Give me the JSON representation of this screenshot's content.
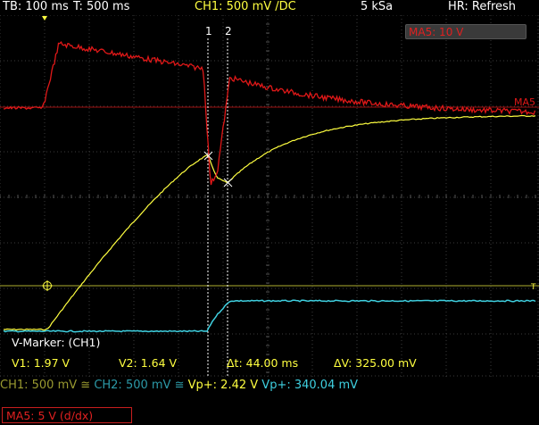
{
  "header": {
    "timebase": "TB: 100 ms",
    "trigger_time": "T: 500 ms",
    "channel1": "CH1: 500 mV /DC",
    "sample_rate": "5 kSa",
    "resolution_mode": "HR: Refresh"
  },
  "markers": {
    "marker1_label": "1",
    "marker2_label": "2",
    "ma5_tag": "MA5",
    "trigger_tag": "T"
  },
  "math_label": "MA5: 10 V",
  "marker_panel": {
    "title": "V-Marker: (CH1)",
    "v1": "V1: 1.97 V",
    "v2": "V2: 1.64 V",
    "dt": "Δt: 44.00 ms",
    "dv": "ΔV: 325.00 mV"
  },
  "measurements": {
    "ch1": "CH1: 500 mV ≅",
    "ch2": "CH2: 500 mV ≅",
    "vp1": "Vp+: 2.42 V",
    "vp2": "Vp+: 340.04 mV"
  },
  "math_footer": "MA5: 5 V (d/dx)",
  "colors": {
    "ch1": "#ffff40",
    "ch2": "#3fd0e0",
    "math": "#e01818",
    "grid": "#3c3c3c"
  }
}
